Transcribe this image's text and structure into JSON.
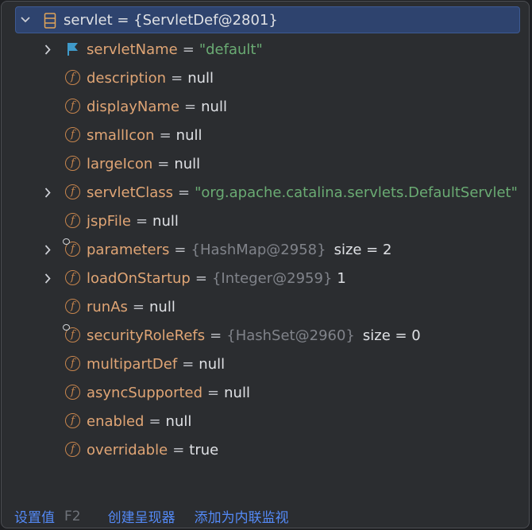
{
  "root": {
    "name": "servlet",
    "eq": " = ",
    "value": "{ServletDef@2801}"
  },
  "fields": [
    {
      "name": "servletName",
      "value": "\"default\"",
      "kind": "string",
      "expandable": true,
      "icon": "flag-icon"
    },
    {
      "name": "description",
      "value": "null",
      "kind": "plain",
      "expandable": false,
      "icon": "field-icon"
    },
    {
      "name": "displayName",
      "value": "null",
      "kind": "plain",
      "expandable": false,
      "icon": "field-icon"
    },
    {
      "name": "smallIcon",
      "value": "null",
      "kind": "plain",
      "expandable": false,
      "icon": "field-icon"
    },
    {
      "name": "largeIcon",
      "value": "null",
      "kind": "plain",
      "expandable": false,
      "icon": "field-icon"
    },
    {
      "name": "servletClass",
      "value": "\"org.apache.catalina.servlets.DefaultServlet\"",
      "kind": "string",
      "expandable": true,
      "icon": "field-icon"
    },
    {
      "name": "jspFile",
      "value": "null",
      "kind": "plain",
      "expandable": false,
      "icon": "field-icon"
    },
    {
      "name": "parameters",
      "value": "{HashMap@2958}",
      "extra": "size = 2",
      "kind": "ref",
      "expandable": true,
      "icon": "field-icon",
      "final": true
    },
    {
      "name": "loadOnStartup",
      "value": "{Integer@2959}",
      "extra": "1",
      "kind": "ref-num",
      "expandable": true,
      "icon": "field-icon"
    },
    {
      "name": "runAs",
      "value": "null",
      "kind": "plain",
      "expandable": false,
      "icon": "field-icon"
    },
    {
      "name": "securityRoleRefs",
      "value": "{HashSet@2960}",
      "extra": "size = 0",
      "kind": "ref",
      "expandable": false,
      "icon": "field-icon",
      "final": true
    },
    {
      "name": "multipartDef",
      "value": "null",
      "kind": "plain",
      "expandable": false,
      "icon": "field-icon"
    },
    {
      "name": "asyncSupported",
      "value": "null",
      "kind": "plain",
      "expandable": false,
      "icon": "field-icon"
    },
    {
      "name": "enabled",
      "value": "null",
      "kind": "plain",
      "expandable": false,
      "icon": "field-icon"
    },
    {
      "name": "overridable",
      "value": "true",
      "kind": "plain",
      "expandable": false,
      "icon": "field-icon"
    }
  ],
  "footer": {
    "set_value": "设置值",
    "set_value_shortcut": "F2",
    "create_renderer": "创建呈现器",
    "add_inline_watch": "添加为内联监视"
  },
  "colors": {
    "field_name": "#e0a575",
    "string_value": "#6aab73",
    "reference": "#80838a",
    "link": "#548af7",
    "selection": "#2e436e"
  }
}
